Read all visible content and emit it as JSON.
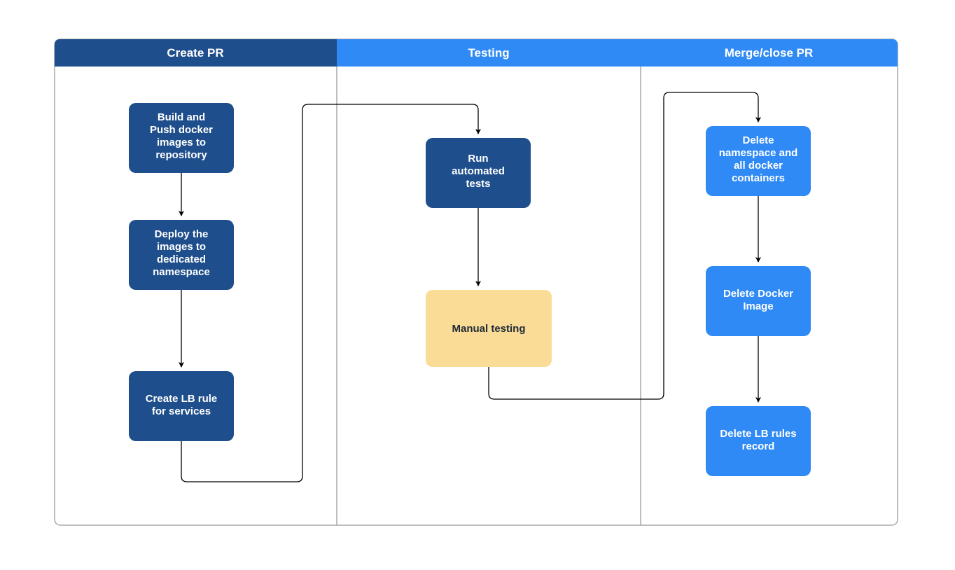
{
  "lanes": {
    "create_pr": {
      "title": "Create PR"
    },
    "testing": {
      "title": "Testing"
    },
    "merge_close": {
      "title": "Merge/close PR"
    }
  },
  "boxes": {
    "build_push": {
      "l1": "Build and",
      "l2": "Push docker",
      "l3": "images to",
      "l4": "repository"
    },
    "deploy": {
      "l1": "Deploy the",
      "l2": "images to",
      "l3": "dedicated",
      "l4": "namespace"
    },
    "create_lb": {
      "l1": "Create LB rule",
      "l2": "for services"
    },
    "run_tests": {
      "l1": "Run",
      "l2": "automated",
      "l3": "tests"
    },
    "manual_testing": {
      "l1": "Manual testing"
    },
    "delete_ns": {
      "l1": "Delete",
      "l2": "namespace and",
      "l3": "all docker",
      "l4": "containers"
    },
    "delete_image": {
      "l1": "Delete Docker",
      "l2": "Image"
    },
    "delete_lb": {
      "l1": "Delete LB rules",
      "l2": "record"
    }
  },
  "colors": {
    "lane_header_dark": "#1e4e8b",
    "lane_header_light": "#2f8af5",
    "box_dark": "#1e4e8b",
    "box_light": "#2f8af5",
    "box_manual": "#fadc96",
    "lane_border": "#a8a8a8"
  }
}
